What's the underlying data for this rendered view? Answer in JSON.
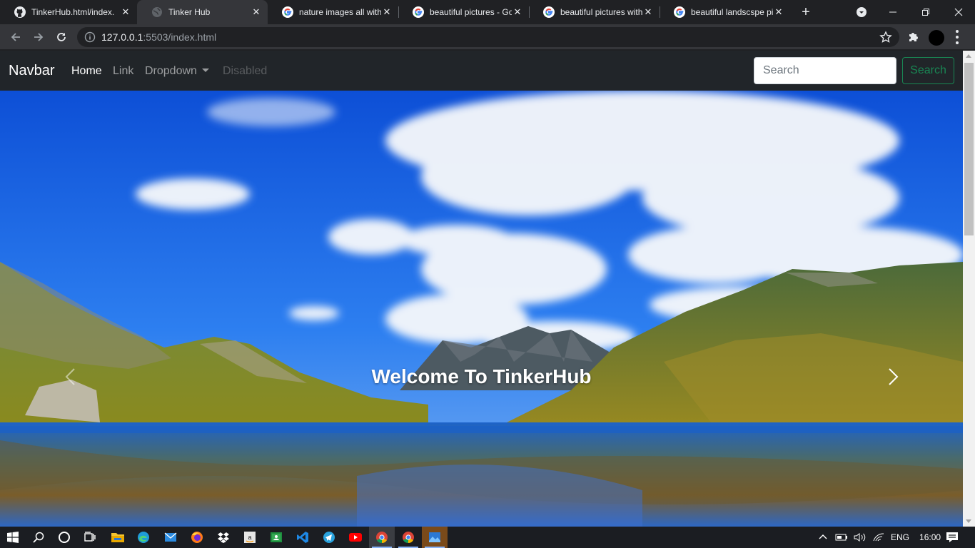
{
  "browser": {
    "tabs": [
      {
        "title": "TinkerHub.html/index.",
        "icon": "github-icon",
        "active": false
      },
      {
        "title": "Tinker Hub",
        "icon": "globe-icon",
        "active": true
      },
      {
        "title": "nature images all with",
        "icon": "google-icon",
        "active": false
      },
      {
        "title": "beautiful pictures - Go",
        "icon": "google-icon",
        "active": false
      },
      {
        "title": "beautiful pictures with",
        "icon": "google-icon",
        "active": false
      },
      {
        "title": "beautiful landscspe pi",
        "icon": "google-icon",
        "active": false
      }
    ],
    "new_tab_label": "+",
    "url_host": "127.0.0.1",
    "url_rest": ":5503/index.html"
  },
  "page": {
    "navbar": {
      "brand": "Navbar",
      "links": [
        {
          "label": "Home",
          "state": "active"
        },
        {
          "label": "Link",
          "state": "normal"
        },
        {
          "label": "Dropdown",
          "state": "dropdown"
        },
        {
          "label": "Disabled",
          "state": "disabled"
        }
      ],
      "search_placeholder": "Search",
      "search_button": "Search"
    },
    "carousel": {
      "caption": "Welcome To TinkerHub",
      "prev_icon": "chevron-left-icon",
      "next_icon": "chevron-right-icon"
    }
  },
  "taskbar": {
    "apps": [
      "start-icon",
      "search-icon",
      "cortana-icon",
      "task-view-icon",
      "file-explorer-icon",
      "edge-icon",
      "mail-icon",
      "firefox-icon",
      "dropbox-icon",
      "amazon-icon",
      "classroom-icon",
      "vscode-icon",
      "telegram-icon",
      "youtube-icon",
      "chrome-icon",
      "chrome-icon",
      "photos-icon"
    ],
    "tray": {
      "language": "ENG",
      "time": "16:00"
    }
  },
  "colors": {
    "navbar_bg": "#212529",
    "search_button": "#198754",
    "browser_frame": "#202124",
    "browser_toolbar": "#35363a"
  }
}
